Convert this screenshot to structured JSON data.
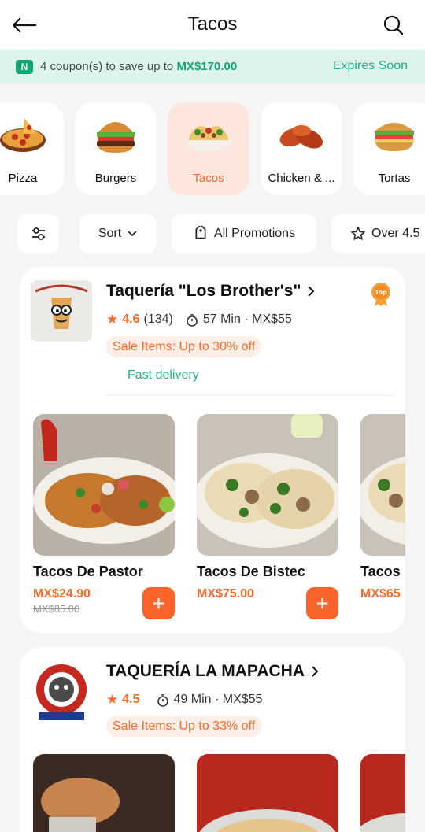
{
  "header": {
    "title": "Tacos",
    "back_icon": "back-arrow-icon",
    "search_icon": "search-icon"
  },
  "coupon": {
    "badge": "N",
    "count_text": "4 coupon(s) to save up to ",
    "amount": "MX$170.00",
    "expires": "Expires Soon"
  },
  "categories": [
    {
      "label": "Pizza",
      "active": false
    },
    {
      "label": "Burgers",
      "active": false
    },
    {
      "label": "Tacos",
      "active": true
    },
    {
      "label": "Chicken & ...",
      "active": false
    },
    {
      "label": "Tortas",
      "active": false
    }
  ],
  "filters": {
    "filter_icon": "sliders-icon",
    "sort": "Sort",
    "promotions": "All Promotions",
    "rating": "Over 4.5"
  },
  "restaurants": [
    {
      "name": "Taquería \"Los Brother's\"",
      "rating": "4.6",
      "reviews": "(134)",
      "time": "57 Min",
      "fee": "· MX$55",
      "sale": "Sale Items: Up to 30% off",
      "tag": "Fast delivery",
      "badge": "Top",
      "dishes": [
        {
          "name": "Tacos De Pastor",
          "price": "MX$24.90",
          "old_price": "MX$85.00"
        },
        {
          "name": "Tacos De Bistec",
          "price": "MX$75.00",
          "old_price": ""
        },
        {
          "name": "Tacos",
          "price": "MX$65",
          "old_price": ""
        }
      ]
    },
    {
      "name": "TAQUERÍA LA MAPACHA",
      "rating": "4.5",
      "time": "49 Min",
      "fee": "· MX$55",
      "sale": "Sale Items: Up to 33% off"
    }
  ],
  "colors": {
    "accent": "#f26a2c",
    "green": "#1fb184",
    "coupon_bg": "#ddf3ec"
  }
}
